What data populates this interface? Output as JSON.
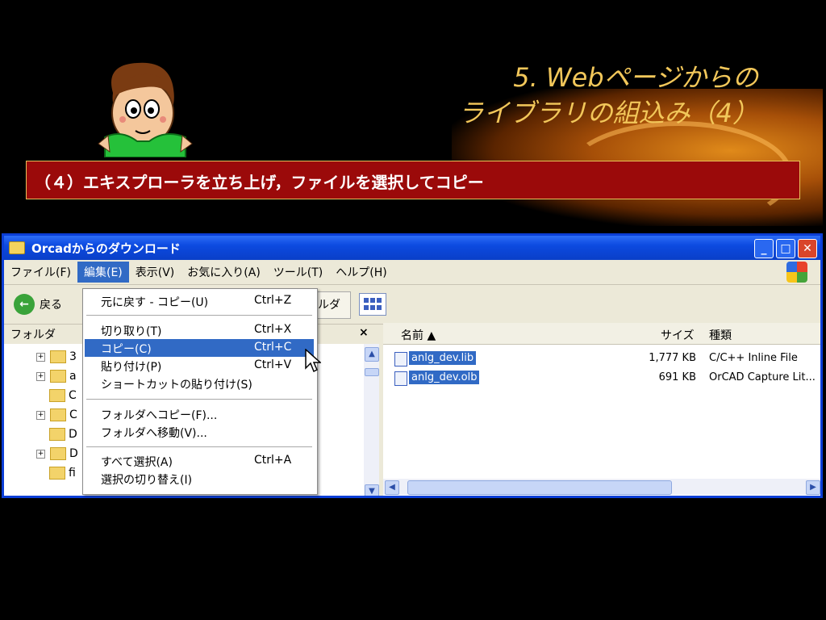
{
  "slide": {
    "title_line1": "5. Webページからの",
    "title_line2": "ライブラリの組込み（4）",
    "banner": "（４）エキスプローラを立ち上げ，ファイルを選択してコピー"
  },
  "window": {
    "title": "Orcadからのダウンロード",
    "menubar": [
      "ファイル(F)",
      "編集(E)",
      "表示(V)",
      "お気に入り(A)",
      "ツール(T)",
      "ヘルプ(H)"
    ],
    "back_label": "戻る",
    "folder_btn_label": "ルダ",
    "left_header": "フォルダ",
    "close_x": "×",
    "tree": [
      {
        "pm": "+",
        "label": "3"
      },
      {
        "pm": "+",
        "label": "a"
      },
      {
        "pm": "",
        "label": "C"
      },
      {
        "pm": "+",
        "label": "C"
      },
      {
        "pm": "",
        "label": "D"
      },
      {
        "pm": "+",
        "label": "D"
      },
      {
        "pm": "",
        "label": "fi"
      }
    ],
    "columns": {
      "name": "名前 ▲",
      "size": "サイズ",
      "type": "種類"
    },
    "files": [
      {
        "name": "anlg_dev.lib",
        "size": "1,777 KB",
        "type": "C/C++ Inline File"
      },
      {
        "name": "anlg_dev.olb",
        "size": "691 KB",
        "type": "OrCAD Capture Lit..."
      }
    ]
  },
  "edit_menu": {
    "undo": {
      "label": "元に戻す - コピー(U)",
      "shortcut": "Ctrl+Z"
    },
    "cut": {
      "label": "切り取り(T)",
      "shortcut": "Ctrl+X"
    },
    "copy": {
      "label": "コピー(C)",
      "shortcut": "Ctrl+C"
    },
    "paste": {
      "label": "貼り付け(P)",
      "shortcut": "Ctrl+V"
    },
    "paste_shortcut": {
      "label": "ショートカットの貼り付け(S)"
    },
    "copy_to": {
      "label": "フォルダへコピー(F)..."
    },
    "move_to": {
      "label": "フォルダへ移動(V)..."
    },
    "select_all": {
      "label": "すべて選択(A)",
      "shortcut": "Ctrl+A"
    },
    "invert": {
      "label": "選択の切り替え(I)"
    }
  },
  "colors": {
    "banner_bg": "#9b0a0a",
    "title": "#f2c75a",
    "highlight": "#316ac5",
    "titlebar": "#0c4ae0"
  }
}
